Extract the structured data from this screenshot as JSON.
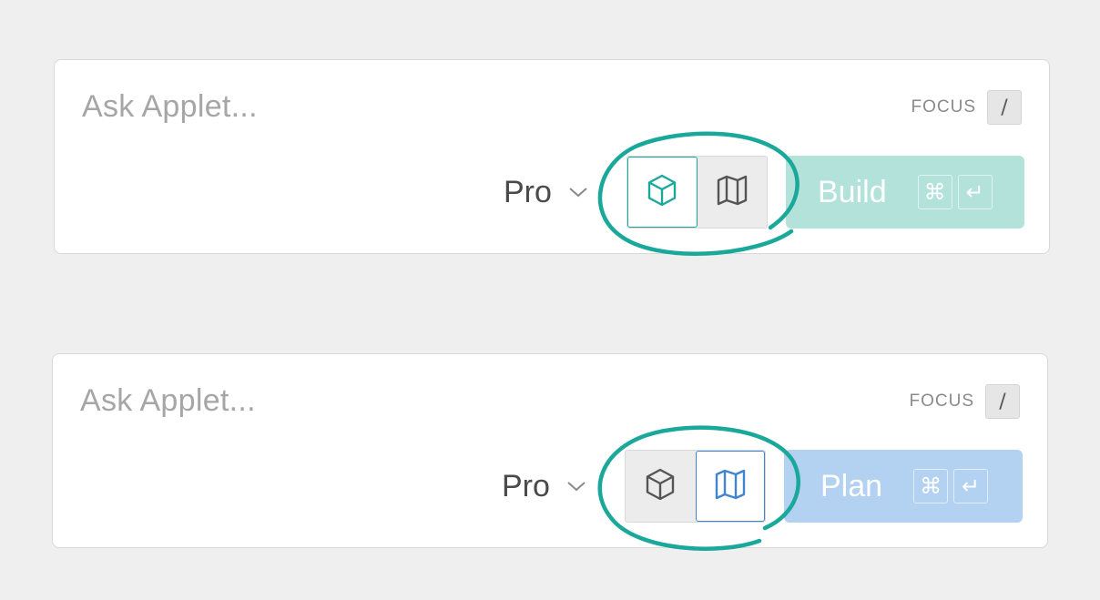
{
  "colors": {
    "page_background": "#efefef",
    "build_accent": "#1aa89a",
    "build_button": "#b2e2da",
    "plan_accent": "#3f86cf",
    "plan_button": "#b3d1f0",
    "annotation_stroke": "#1aa89a"
  },
  "cards": [
    {
      "prompt_placeholder": "Ask Applet...",
      "focus_label": "FOCUS",
      "focus_key": "/",
      "model": "Pro",
      "mode_buttons": [
        {
          "icon": "cube-icon",
          "active": true
        },
        {
          "icon": "map-icon",
          "active": false
        }
      ],
      "action_label": "Build",
      "action_keys": [
        "⌘",
        "↵"
      ]
    },
    {
      "prompt_placeholder": "Ask Applet...",
      "focus_label": "FOCUS",
      "focus_key": "/",
      "model": "Pro",
      "mode_buttons": [
        {
          "icon": "cube-icon",
          "active": false
        },
        {
          "icon": "map-icon",
          "active": true
        }
      ],
      "action_label": "Plan",
      "action_keys": [
        "⌘",
        "↵"
      ]
    }
  ]
}
